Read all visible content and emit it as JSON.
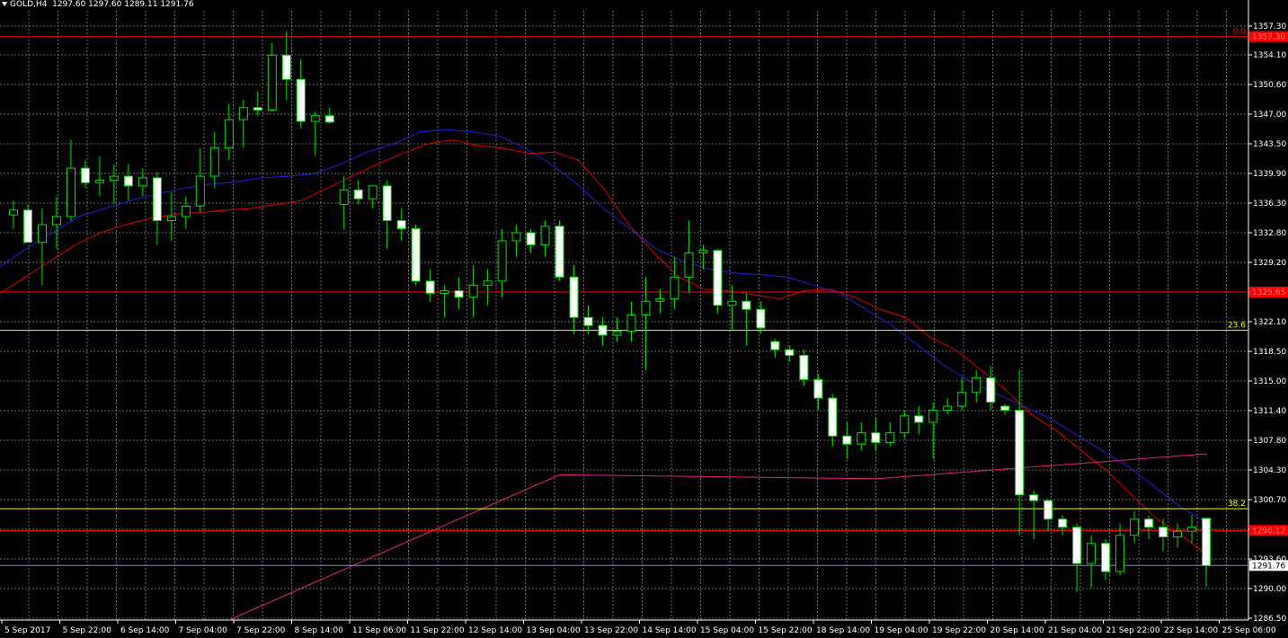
{
  "header": {
    "symbol": "GOLD,H4",
    "ohlc": "1297.60 1297.60 1289.11 1291.76"
  },
  "colors": {
    "background": "#000000",
    "grid": "#6b6b6b",
    "axis": "#ffffff",
    "bull_candle": "#000000",
    "bear_candle": "#ffffff",
    "candle_outline": "#00e000",
    "ma_fast": "#e00000",
    "ma_slow": "#2020e0",
    "ma_long": "#e0207f",
    "fib_line": "#ffff00",
    "price_line": "#ff0000",
    "bid_line": "#8080ff"
  },
  "chart_data": {
    "type": "candlestick",
    "ylim": [
      1285.0,
      1360.5
    ],
    "y_ticks": [
      "1357.30",
      "1354.10",
      "1350.60",
      "1347.00",
      "1343.50",
      "1339.90",
      "1336.30",
      "1332.80",
      "1329.20",
      "1325.65",
      "1322.10",
      "1318.50",
      "1315.00",
      "1311.40",
      "1307.80",
      "1304.30",
      "1300.70",
      "1297.20",
      "1293.60",
      "1290.00",
      "1286.50"
    ],
    "x_labels": [
      "5 Sep 2017",
      "5 Sep 22:00",
      "6 Sep 14:00",
      "7 Sep 04:00",
      "7 Sep 22:00",
      "8 Sep 14:00",
      "11 Sep 06:00",
      "11 Sep 22:00",
      "12 Sep 14:00",
      "13 Sep 04:00",
      "13 Sep 22:00",
      "14 Sep 14:00",
      "15 Sep 04:00",
      "15 Sep 22:00",
      "18 Sep 14:00",
      "19 Sep 04:00",
      "19 Sep 22:00",
      "20 Sep 14:00",
      "21 Sep 04:00",
      "21 Sep 22:00",
      "22 Sep 14:00",
      "25 Sep 06:00"
    ],
    "horizontal_levels": [
      {
        "price": 1357.3,
        "color": "#ff0000",
        "label": "0.0"
      },
      {
        "price": 1325.65,
        "color": "#ff0000",
        "label": ""
      },
      {
        "price": 1320.9,
        "color": "#ffff00",
        "label": "23.6"
      },
      {
        "price": 1298.8,
        "color": "#ffff00",
        "label": "38.2"
      },
      {
        "price": 1296.1,
        "color": "#ff0000",
        "label": ""
      },
      {
        "price": 1291.76,
        "color": "#8080ff",
        "label": ""
      }
    ],
    "price_tags": [
      {
        "text": "1357.30",
        "price": 1357.3,
        "bg": "#ff0000",
        "fg": "#ff8080"
      },
      {
        "text": "1325.65",
        "price": 1325.65,
        "bg": "#ff0000",
        "fg": "#ff8080"
      },
      {
        "text": "1296.12",
        "price": 1296.1,
        "bg": "#ff0000",
        "fg": "#ff8080"
      },
      {
        "text": "1291.76",
        "price": 1291.76,
        "bg": "#ffffff",
        "fg": "#000000"
      }
    ],
    "candles": [
      {
        "o": 1335.2,
        "h": 1337.0,
        "l": 1333.5,
        "c": 1335.8
      },
      {
        "o": 1335.8,
        "h": 1336.5,
        "l": 1332.0,
        "c": 1331.8
      },
      {
        "o": 1331.8,
        "h": 1336.0,
        "l": 1326.5,
        "c": 1334.0
      },
      {
        "o": 1334.0,
        "h": 1337.5,
        "l": 1331.0,
        "c": 1335.0
      },
      {
        "o": 1335.0,
        "h": 1344.5,
        "l": 1334.5,
        "c": 1341.0
      },
      {
        "o": 1341.0,
        "h": 1342.0,
        "l": 1338.5,
        "c": 1339.2
      },
      {
        "o": 1339.2,
        "h": 1342.5,
        "l": 1337.5,
        "c": 1339.5
      },
      {
        "o": 1339.5,
        "h": 1341.5,
        "l": 1336.5,
        "c": 1340.0
      },
      {
        "o": 1340.0,
        "h": 1341.5,
        "l": 1337.0,
        "c": 1338.8
      },
      {
        "o": 1338.8,
        "h": 1341.0,
        "l": 1337.5,
        "c": 1339.8
      },
      {
        "o": 1339.8,
        "h": 1340.5,
        "l": 1331.5,
        "c": 1334.5
      },
      {
        "o": 1334.5,
        "h": 1338.0,
        "l": 1332.0,
        "c": 1335.0
      },
      {
        "o": 1335.0,
        "h": 1337.5,
        "l": 1333.5,
        "c": 1336.3
      },
      {
        "o": 1336.3,
        "h": 1343.5,
        "l": 1335.5,
        "c": 1340.0
      },
      {
        "o": 1340.0,
        "h": 1345.5,
        "l": 1338.5,
        "c": 1343.5
      },
      {
        "o": 1343.5,
        "h": 1349.0,
        "l": 1342.0,
        "c": 1347.0
      },
      {
        "o": 1347.0,
        "h": 1349.5,
        "l": 1343.5,
        "c": 1348.5
      },
      {
        "o": 1348.5,
        "h": 1350.5,
        "l": 1347.5,
        "c": 1348.2
      },
      {
        "o": 1348.2,
        "h": 1356.5,
        "l": 1348.0,
        "c": 1355.0
      },
      {
        "o": 1355.0,
        "h": 1358.0,
        "l": 1349.5,
        "c": 1352.0
      },
      {
        "o": 1352.0,
        "h": 1354.5,
        "l": 1346.0,
        "c": 1346.8
      },
      {
        "o": 1346.8,
        "h": 1348.0,
        "l": 1342.5,
        "c": 1347.5
      },
      {
        "o": 1347.5,
        "h": 1348.5,
        "l": 1346.5,
        "c": 1346.7
      },
      {
        "o": 1336.5,
        "h": 1340.0,
        "l": 1333.5,
        "c": 1338.3
      },
      {
        "o": 1338.3,
        "h": 1339.5,
        "l": 1336.5,
        "c": 1337.2
      },
      {
        "o": 1337.2,
        "h": 1338.8,
        "l": 1336.0,
        "c": 1338.8
      },
      {
        "o": 1338.8,
        "h": 1339.5,
        "l": 1331.0,
        "c": 1334.5
      },
      {
        "o": 1334.5,
        "h": 1336.0,
        "l": 1332.0,
        "c": 1333.5
      },
      {
        "o": 1333.5,
        "h": 1334.0,
        "l": 1326.5,
        "c": 1327.0
      },
      {
        "o": 1327.0,
        "h": 1328.5,
        "l": 1324.5,
        "c": 1325.5
      },
      {
        "o": 1325.5,
        "h": 1326.5,
        "l": 1322.5,
        "c": 1325.8
      },
      {
        "o": 1325.8,
        "h": 1327.5,
        "l": 1323.5,
        "c": 1325.0
      },
      {
        "o": 1325.0,
        "h": 1329.0,
        "l": 1322.5,
        "c": 1326.5
      },
      {
        "o": 1326.5,
        "h": 1328.5,
        "l": 1324.0,
        "c": 1327.0
      },
      {
        "o": 1327.0,
        "h": 1333.5,
        "l": 1325.0,
        "c": 1332.0
      },
      {
        "o": 1332.0,
        "h": 1334.0,
        "l": 1330.0,
        "c": 1333.0
      },
      {
        "o": 1333.0,
        "h": 1333.5,
        "l": 1330.5,
        "c": 1331.5
      },
      {
        "o": 1331.5,
        "h": 1334.5,
        "l": 1330.0,
        "c": 1333.8
      },
      {
        "o": 1333.8,
        "h": 1334.5,
        "l": 1327.0,
        "c": 1327.5
      },
      {
        "o": 1327.5,
        "h": 1329.0,
        "l": 1320.5,
        "c": 1322.5
      },
      {
        "o": 1322.5,
        "h": 1324.0,
        "l": 1320.5,
        "c": 1321.5
      },
      {
        "o": 1321.5,
        "h": 1322.5,
        "l": 1319.0,
        "c": 1320.3
      },
      {
        "o": 1320.3,
        "h": 1322.5,
        "l": 1319.5,
        "c": 1320.8
      },
      {
        "o": 1320.8,
        "h": 1324.5,
        "l": 1319.5,
        "c": 1322.8
      },
      {
        "o": 1322.8,
        "h": 1327.5,
        "l": 1316.0,
        "c": 1324.5
      },
      {
        "o": 1324.5,
        "h": 1326.0,
        "l": 1323.0,
        "c": 1324.8
      },
      {
        "o": 1324.8,
        "h": 1330.0,
        "l": 1323.5,
        "c": 1327.5
      },
      {
        "o": 1327.5,
        "h": 1334.5,
        "l": 1325.5,
        "c": 1330.5
      },
      {
        "o": 1330.5,
        "h": 1331.5,
        "l": 1328.5,
        "c": 1330.8
      },
      {
        "o": 1330.8,
        "h": 1331.0,
        "l": 1323.0,
        "c": 1324.0
      },
      {
        "o": 1324.0,
        "h": 1326.5,
        "l": 1321.0,
        "c": 1324.5
      },
      {
        "o": 1324.5,
        "h": 1325.5,
        "l": 1319.0,
        "c": 1323.5
      },
      {
        "o": 1323.5,
        "h": 1324.5,
        "l": 1320.5,
        "c": 1321.2
      },
      {
        "o": 1319.5,
        "h": 1319.8,
        "l": 1317.5,
        "c": 1318.5
      },
      {
        "o": 1318.5,
        "h": 1319.0,
        "l": 1317.0,
        "c": 1317.8
      },
      {
        "o": 1317.8,
        "h": 1318.5,
        "l": 1314.0,
        "c": 1314.8
      },
      {
        "o": 1314.8,
        "h": 1315.5,
        "l": 1311.0,
        "c": 1312.5
      },
      {
        "o": 1312.5,
        "h": 1313.0,
        "l": 1306.5,
        "c": 1307.8
      },
      {
        "o": 1307.8,
        "h": 1309.5,
        "l": 1305.0,
        "c": 1306.8
      },
      {
        "o": 1306.8,
        "h": 1309.5,
        "l": 1306.0,
        "c": 1308.2
      },
      {
        "o": 1308.2,
        "h": 1310.0,
        "l": 1306.0,
        "c": 1307.0
      },
      {
        "o": 1307.0,
        "h": 1309.5,
        "l": 1306.5,
        "c": 1308.2
      },
      {
        "o": 1308.2,
        "h": 1311.0,
        "l": 1307.5,
        "c": 1310.3
      },
      {
        "o": 1310.3,
        "h": 1311.5,
        "l": 1308.0,
        "c": 1309.5
      },
      {
        "o": 1309.5,
        "h": 1312.0,
        "l": 1305.0,
        "c": 1311.0
      },
      {
        "o": 1311.0,
        "h": 1312.5,
        "l": 1310.5,
        "c": 1311.5
      },
      {
        "o": 1311.5,
        "h": 1315.0,
        "l": 1311.0,
        "c": 1313.2
      },
      {
        "o": 1313.2,
        "h": 1316.0,
        "l": 1312.0,
        "c": 1315.0
      },
      {
        "o": 1315.0,
        "h": 1316.5,
        "l": 1311.0,
        "c": 1312.0
      },
      {
        "o": 1311.5,
        "h": 1311.8,
        "l": 1310.5,
        "c": 1311.0
      },
      {
        "o": 1311.0,
        "h": 1316.0,
        "l": 1295.5,
        "c": 1300.5
      },
      {
        "o": 1300.5,
        "h": 1301.0,
        "l": 1295.0,
        "c": 1299.8
      },
      {
        "o": 1299.8,
        "h": 1300.0,
        "l": 1296.0,
        "c": 1297.5
      },
      {
        "o": 1297.5,
        "h": 1298.0,
        "l": 1295.5,
        "c": 1296.5
      },
      {
        "o": 1296.5,
        "h": 1297.0,
        "l": 1288.5,
        "c": 1292.0
      },
      {
        "o": 1292.0,
        "h": 1295.5,
        "l": 1289.0,
        "c": 1294.5
      },
      {
        "o": 1294.5,
        "h": 1295.0,
        "l": 1290.0,
        "c": 1291.0
      },
      {
        "o": 1291.0,
        "h": 1297.0,
        "l": 1290.5,
        "c": 1295.5
      },
      {
        "o": 1295.5,
        "h": 1298.5,
        "l": 1294.5,
        "c": 1297.5
      },
      {
        "o": 1297.5,
        "h": 1298.0,
        "l": 1295.0,
        "c": 1296.5
      },
      {
        "o": 1296.5,
        "h": 1297.5,
        "l": 1293.5,
        "c": 1295.3
      },
      {
        "o": 1295.3,
        "h": 1297.0,
        "l": 1294.0,
        "c": 1296.0
      },
      {
        "o": 1296.0,
        "h": 1298.0,
        "l": 1294.5,
        "c": 1296.5
      },
      {
        "o": 1297.6,
        "h": 1297.6,
        "l": 1289.11,
        "c": 1291.76
      }
    ],
    "ma_fast": [
      1325.5,
      1327.5,
      1329.5,
      1331.5,
      1333.0,
      1334.0,
      1334.8,
      1335.3,
      1335.5,
      1335.8,
      1336.0,
      1336.5,
      1337.0,
      1338.5,
      1340.0,
      1341.5,
      1342.8,
      1344.0,
      1344.5,
      1343.8,
      1343.5,
      1342.8,
      1343.0,
      1342.0,
      1338.5,
      1334.0,
      1330.5,
      1327.5,
      1326.0,
      1325.8,
      1325.3,
      1324.8,
      1325.8,
      1326.0,
      1325.0,
      1323.5,
      1322.5,
      1320.0,
      1318.5,
      1316.0,
      1313.5,
      1310.5,
      1308.5,
      1306.0,
      1303.5,
      1300.5,
      1297.5,
      1295.5,
      1293.0
    ],
    "ma_slow": [
      1328.8,
      1331.0,
      1333.0,
      1335.0,
      1336.0,
      1337.0,
      1337.8,
      1338.5,
      1339.0,
      1339.3,
      1339.8,
      1340.0,
      1340.3,
      1341.5,
      1343.0,
      1344.0,
      1345.5,
      1345.8,
      1345.5,
      1345.0,
      1343.5,
      1341.5,
      1339.0,
      1336.0,
      1333.5,
      1331.0,
      1329.5,
      1328.5,
      1328.0,
      1327.8,
      1327.5,
      1326.5,
      1325.5,
      1323.5,
      1321.5,
      1319.0,
      1316.5,
      1314.5,
      1313.0,
      1311.5,
      1310.0,
      1308.0,
      1306.0,
      1304.0,
      1301.5,
      1299.0,
      1297.0
    ]
  }
}
